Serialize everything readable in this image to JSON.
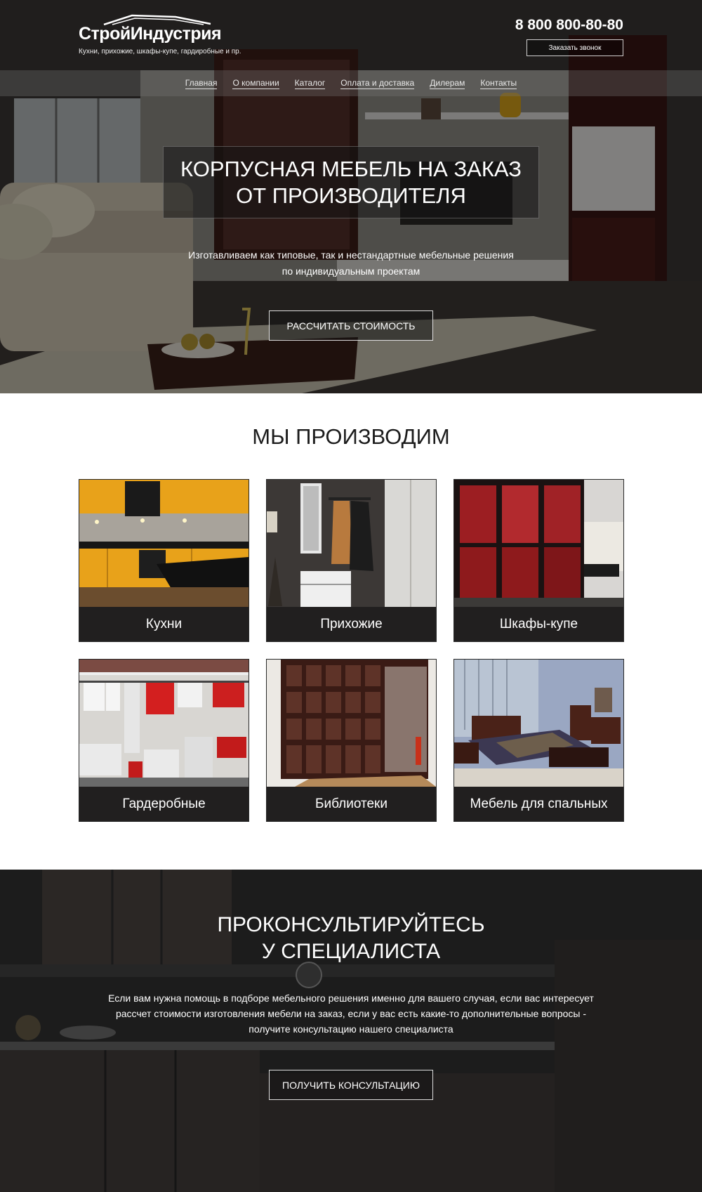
{
  "header": {
    "logo_name": "СтройИндустрия",
    "logo_tagline": "Кухни, прихожие, шкафы-купе, гардиробные и пр.",
    "phone": "8 800 800-80-80",
    "callback_label": "Заказать звонок"
  },
  "nav": {
    "items": [
      "Главная",
      "О компании",
      "Каталог",
      "Оплата и доставка",
      "Дилерам",
      "Контакты"
    ]
  },
  "hero": {
    "title_line1": "КОРПУСНАЯ МЕБЕЛЬ НА ЗАКАЗ",
    "title_line2": "ОТ ПРОИЗВОДИТЕЛЯ",
    "subtitle_line1": "Изготавливаем как типовые, так и нестандартные мебельные решения",
    "subtitle_line2": "по индивидуальным проектам",
    "cta_label": "РАССЧИТАТЬ СТОИМОСТЬ"
  },
  "products": {
    "title": "МЫ ПРОИЗВОДИМ",
    "items": [
      {
        "label": "Кухни"
      },
      {
        "label": "Прихожие"
      },
      {
        "label": "Шкафы-купе"
      },
      {
        "label": "Гардеробные"
      },
      {
        "label": "Библиотеки"
      },
      {
        "label": "Мебель для спальных"
      }
    ]
  },
  "consult": {
    "title_line1": "ПРОКОНСУЛЬТИРУЙТЕСЬ",
    "title_line2": "У СПЕЦИАЛИСТА",
    "text_line1": "Если вам нужна помощь в подборе мебельного решения именно для вашего случая, если вас интересует",
    "text_line2": "рассчет стоимости изготовления мебели на заказ, если у вас есть какие-то дополнительные вопросы -",
    "text_line3": "получите консультацию нашего специалиста",
    "cta_label": "ПОЛУЧИТЬ КОНСУЛЬТАЦИЮ"
  },
  "colors": {
    "dark": "#211f1f",
    "kitchen_accent": "#e8a21a",
    "wardrobe_accent": "#8e1a1c"
  }
}
